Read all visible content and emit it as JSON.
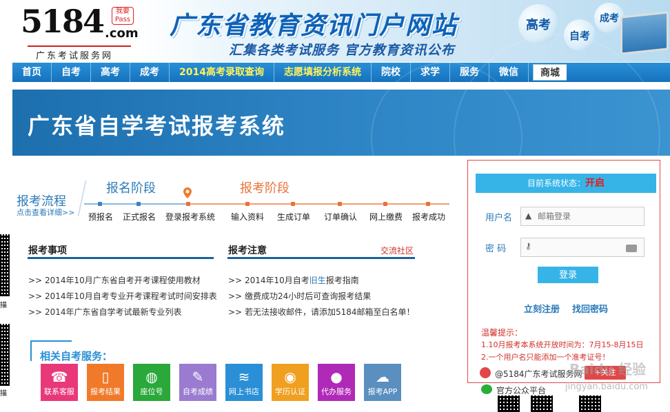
{
  "left_strip": {
    "qr_caption_1": "描",
    "qr_caption_2": "描"
  },
  "logo": {
    "main": "5184",
    "dotcom": ".com",
    "badge": "我要Pass",
    "subtitle": "广东考试服务网"
  },
  "banner": {
    "title": "广东省教育资讯门户网站",
    "subtitle": "汇集各类考试服务  官方教育资讯公布",
    "bubbles": {
      "gaokao": "高考",
      "zikao": "自考",
      "chengkao": "成考"
    }
  },
  "nav": {
    "items": [
      {
        "label": "首页",
        "highlight": false
      },
      {
        "label": "自考",
        "highlight": false
      },
      {
        "label": "高考",
        "highlight": false
      },
      {
        "label": "成考",
        "highlight": false
      },
      {
        "label": "2014高考录取查询",
        "highlight": true
      },
      {
        "label": "志愿填报分析系统",
        "highlight": true
      },
      {
        "label": "院校",
        "highlight": false
      },
      {
        "label": "求学",
        "highlight": false
      },
      {
        "label": "服务",
        "highlight": false
      },
      {
        "label": "微信",
        "highlight": false
      },
      {
        "label": "商城",
        "highlight": false
      }
    ]
  },
  "page_title": "广东省自学考试报考系统",
  "process": {
    "label": "报考流程",
    "detail_link": "点击查看详细>>",
    "stage1": "报名阶段",
    "stage2": "报考阶段",
    "steps": [
      "预报名",
      "正式报名",
      "登录报考系统",
      "输入资料",
      "生成订单",
      "订单确认",
      "网上缴费",
      "报考成功"
    ]
  },
  "notices": {
    "title": "报考事项",
    "items": [
      "2014年10月广东省自考开考课程使用教材",
      "2014年10月自考专业开考课程考试时间安排表",
      "2014年广东省自学考试最新专业列表"
    ]
  },
  "notes": {
    "title": "报考注意",
    "community_link": "交流社区",
    "item1_pre": "2014年10月自考",
    "item1_blue": "旧生",
    "item1_post": "报考指南",
    "item2": "缴费成功24小时后可查询报考结果",
    "item3": "若无法接收邮件，请添加5184邮箱至白名单！",
    "bullet": ">>"
  },
  "services": {
    "title": "相关自考服务：",
    "items": [
      {
        "label": "联系客服",
        "icon": "phone-icon",
        "glyph": "☎",
        "color": "#e8387a"
      },
      {
        "label": "报考结果",
        "icon": "mobile-icon",
        "glyph": "▯",
        "color": "#f07a2a"
      },
      {
        "label": "座位号",
        "icon": "chair-icon",
        "glyph": "◍",
        "color": "#2aa83a"
      },
      {
        "label": "自考成绩",
        "icon": "pen-icon",
        "glyph": "✎",
        "color": "#9a7bd0"
      },
      {
        "label": "网上书店",
        "icon": "books-icon",
        "glyph": "≋",
        "color": "#2a8fd6"
      },
      {
        "label": "学历认证",
        "icon": "seal-icon",
        "glyph": "◉",
        "color": "#f0a020"
      },
      {
        "label": "代办服务",
        "icon": "person-icon",
        "glyph": "●",
        "color": "#b02ab8"
      },
      {
        "label": "报考APP",
        "icon": "cloud-download-icon",
        "glyph": "☁",
        "color": "#5a8fc0"
      }
    ]
  },
  "login": {
    "status_label": "目前系统状态：",
    "status_value": "开启",
    "username_label": "用户名",
    "username_placeholder": "邮箱登录",
    "password_label": "密  码",
    "password_value": "",
    "login_button": "登录",
    "register_link": "立刻注册",
    "recover_link": "找回密码",
    "tips_title": "温馨提示：",
    "tip1": "1.10月报考本系统开放时间为：7月15-8月15日",
    "tip2": "2.一个用户名只能添加一个准考证号！",
    "weibo_text": "@5184广东考试服务网",
    "follow_label": "+关注",
    "wechat_text": "官方公众平台",
    "watermark": "Baidu 经验",
    "watermark_url": "jingyan.baidu.com"
  }
}
